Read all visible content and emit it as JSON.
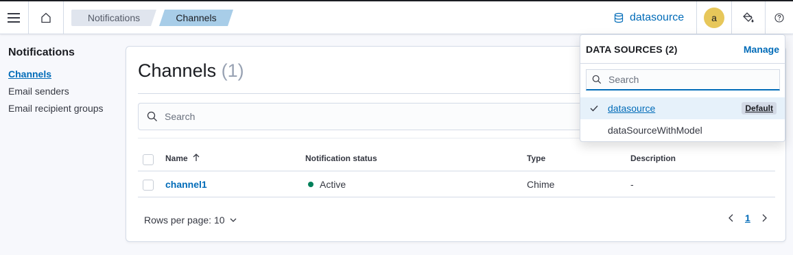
{
  "header": {
    "breadcrumbs": [
      "Notifications",
      "Channels"
    ],
    "datasource_label": "datasource",
    "avatar_initial": "a"
  },
  "sidebar": {
    "title": "Notifications",
    "items": [
      {
        "label": "Channels",
        "active": true
      },
      {
        "label": "Email senders",
        "active": false
      },
      {
        "label": "Email recipient groups",
        "active": false
      }
    ]
  },
  "main": {
    "title": "Channels",
    "count": "(1)",
    "search_placeholder": "Search",
    "columns": [
      "Name",
      "Notification status",
      "Type",
      "Description"
    ],
    "rows": [
      {
        "name": "channel1",
        "status": "Active",
        "type": "Chime",
        "description": "-"
      }
    ],
    "rows_per_page": "Rows per page: 10",
    "current_page": "1"
  },
  "datasource_popover": {
    "heading": "DATA SOURCES (2)",
    "manage_label": "Manage",
    "search_placeholder": "Search",
    "options": [
      {
        "label": "datasource",
        "selected": true,
        "badge": "Default"
      },
      {
        "label": "dataSourceWithModel",
        "selected": false
      }
    ]
  },
  "colors": {
    "link": "#006bb8",
    "active_status": "#00805a",
    "avatar": "#e7c75a",
    "breadcrumb_active": "#a8cde8"
  }
}
